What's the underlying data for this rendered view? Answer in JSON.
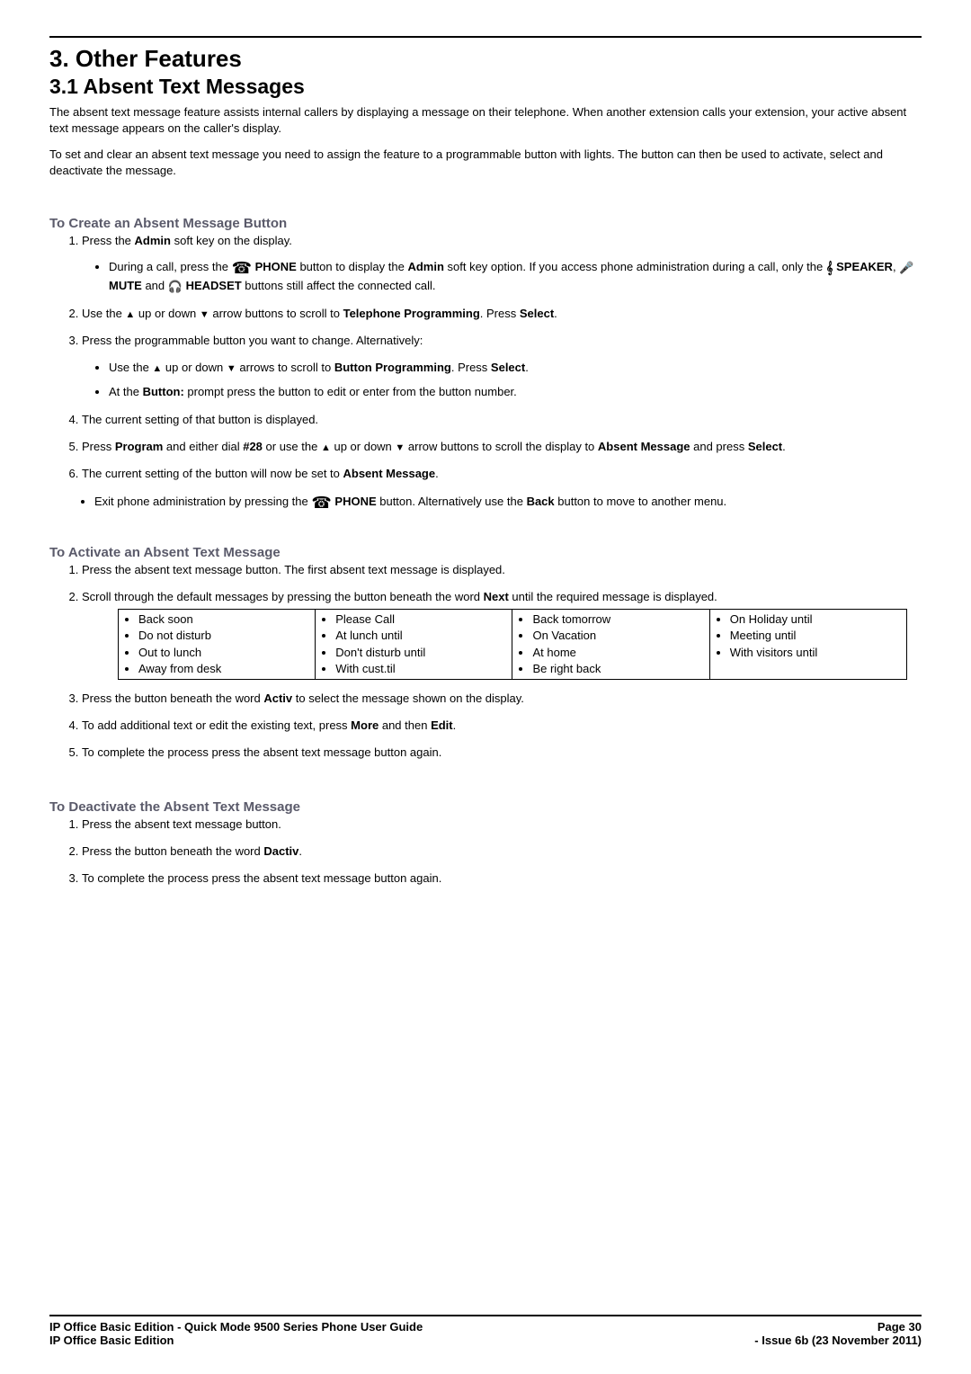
{
  "headings": {
    "h1": "3. Other Features",
    "h2": "3.1 Absent Text Messages",
    "create": "To Create an Absent Message Button",
    "activate": "To Activate an Absent Text Message",
    "deactivate": "To Deactivate the Absent Text Message"
  },
  "intro": {
    "p1": "The absent text message feature assists internal callers by displaying a message on their telephone. When another extension calls your extension, your active absent text message appears on the caller's display.",
    "p2": "To set and clear an absent text message you need to assign the feature to a programmable button with lights. The button can then be used to activate, select and deactivate the message."
  },
  "create": {
    "step1": "Press the ",
    "step1b": " soft key on the display.",
    "step1_bullet_a": "During a call, press the ",
    "step1_bullet_b": " button to display the ",
    "step1_bullet_c": " soft key option. If you access phone administration during a call, only the ",
    "step1_bullet_d": " and ",
    "step1_bullet_e": " buttons still affect the connected call.",
    "step2a": "Use the ",
    "step2b": " up or down ",
    "step2c": " arrow buttons to scroll to ",
    "step2d": ". Press ",
    "step3": "Press the programmable button you want to change. Alternatively:",
    "step3_b1a": "Use the ",
    "step3_b1b": " up or down ",
    "step3_b1c": " arrows to scroll to ",
    "step3_b1d": ". Press ",
    "step3_b2a": "At the ",
    "step3_b2b": " prompt press the button to edit or enter from the button number.",
    "step4": "The current setting of that button is displayed.",
    "step5a": "Press ",
    "step5b": " and either dial ",
    "step5c": " or use the ",
    "step5d": " up or down ",
    "step5e": " arrow buttons to scroll the display to ",
    "step5f": " and press ",
    "step6a": "The current setting of the button will now be set to ",
    "step7a": "Exit phone administration by pressing the ",
    "step7b": " button. Alternatively use the ",
    "step7c": " button to move to another menu."
  },
  "labels": {
    "admin": "Admin",
    "phone": " PHONE",
    "speaker": " SPEAKER",
    "mute": " MUTE",
    "headset": " HEADSET",
    "tel_prog": "Telephone Programming",
    "btn_prog": "Button Programming",
    "select": "Select",
    "button": "Button:",
    "program": "Program",
    "code": "#28",
    "absent_msg": "Absent Message",
    "back": "Back",
    "next": "Next",
    "activ": "Activ",
    "more": "More",
    "edit": "Edit",
    "dactiv": "Dactiv",
    "period": ".",
    "comma": ", "
  },
  "activate": {
    "step1": "Press the absent text message button. The first absent text message is displayed.",
    "step2a": "Scroll through the default messages by pressing the button beneath the word ",
    "step2b": " until the required message is displayed.",
    "step3a": "Press the button beneath the word ",
    "step3b": "  to select the message shown on the display.",
    "step4a": "To add additional text or edit the existing text, press ",
    "step4b": " and then ",
    "step5": "To complete the process press the absent text message button again."
  },
  "messages": {
    "col1": [
      "Back soon",
      "Do not disturb",
      "Out to lunch",
      "Away from desk"
    ],
    "col2": [
      "Please Call",
      "At lunch until",
      "Don't disturb until",
      "With cust.til"
    ],
    "col3": [
      "Back tomorrow",
      "On Vacation",
      "At home",
      "Be right back"
    ],
    "col4": [
      "On Holiday until",
      "Meeting until",
      "With visitors until"
    ]
  },
  "deactivate": {
    "step1": "Press the absent text message button.",
    "step2a": "Press the button beneath the word ",
    "step3": "To complete the process press the absent text message button again."
  },
  "footer": {
    "left1": "IP Office Basic Edition - Quick Mode 9500 Series Phone User Guide",
    "left2": "IP Office Basic Edition",
    "right1": "Page 30",
    "right2": "- Issue 6b (23 November 2011)"
  }
}
